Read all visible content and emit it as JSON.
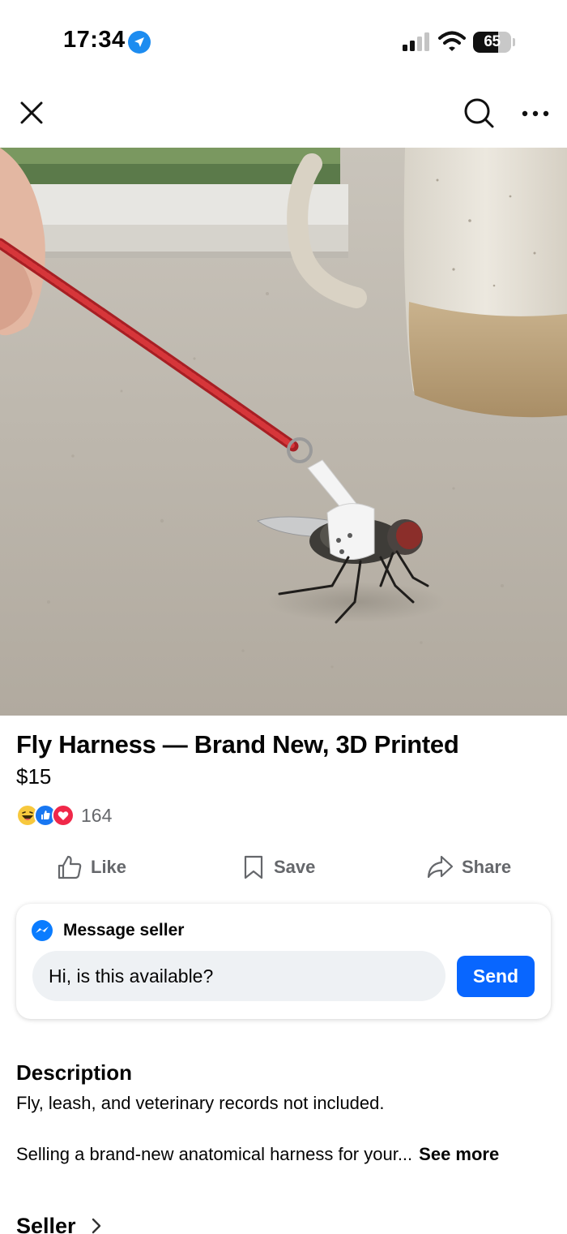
{
  "status_bar": {
    "time": "17:34",
    "battery": "65",
    "battery_level": 0.65,
    "icons": [
      "location-arrow-icon",
      "cellular-signal-icon",
      "wifi-icon",
      "battery-icon"
    ]
  },
  "top_bar": {
    "icons": [
      "close-icon",
      "search-icon",
      "more-options-icon"
    ]
  },
  "photo": {
    "page_count": 4,
    "current_page": 1
  },
  "listing": {
    "title": "Fly Harness — Brand New, 3D Printed",
    "price": "$15",
    "reaction_count": "164",
    "reaction_icons": [
      "haha-reaction-icon",
      "like-reaction-icon",
      "love-reaction-icon"
    ]
  },
  "actions": {
    "like": "Like",
    "save": "Save",
    "share": "Share"
  },
  "message": {
    "header": "Message seller",
    "input_value": "Hi, is this available?",
    "send": "Send"
  },
  "description": {
    "title": "Description",
    "line1": "Fly, leash, and veterinary records not included.",
    "line2": "Selling a brand-new anatomical harness for your...",
    "see_more": "See more"
  },
  "seller": {
    "label": "Seller"
  },
  "colors": {
    "accent_blue": "#0866ff",
    "secondary_text": "#65676b",
    "leash_red": "#c8282c"
  }
}
